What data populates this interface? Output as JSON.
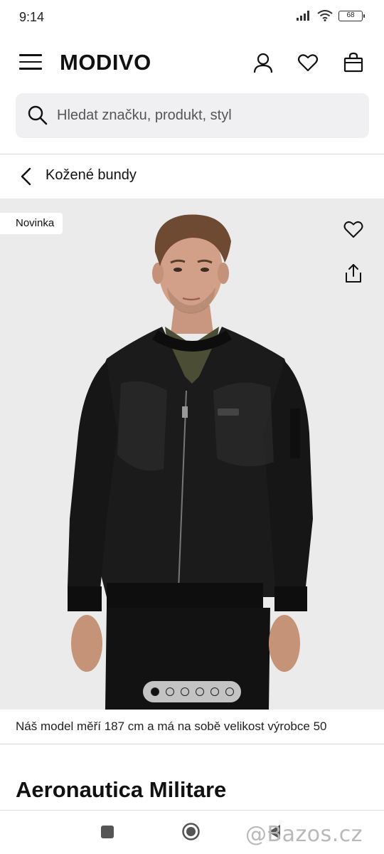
{
  "status_bar": {
    "time": "9:14",
    "battery": "68"
  },
  "header": {
    "logo": "MODIVO",
    "icons": [
      "menu-icon",
      "user-icon",
      "heart-icon",
      "bag-icon"
    ]
  },
  "search": {
    "placeholder": "Hledat značku, produkt, styl"
  },
  "breadcrumb": {
    "label": "Kožené bundy"
  },
  "gallery": {
    "badge": "Novinka",
    "image_count": 6,
    "active_index": 0,
    "background": "#ebebeb"
  },
  "product": {
    "model_note": "Náš model měří 187 cm a má na sobě velikost výrobce 50",
    "brand": "Aeronautica Militare"
  },
  "watermark": "@Bazos.cz",
  "colors": {
    "text": "#111111",
    "search_bg": "#f0f0f2",
    "divider": "#d8d8d8"
  }
}
